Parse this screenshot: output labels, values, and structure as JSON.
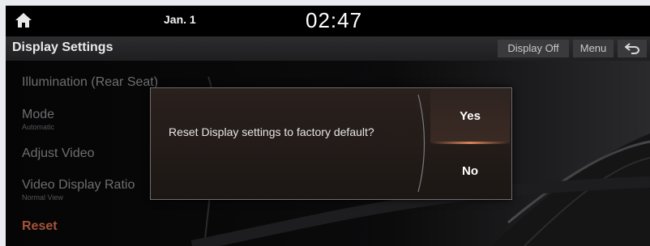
{
  "status_bar": {
    "home_icon": "home-icon",
    "date": "Jan. 1",
    "time": "02:47"
  },
  "title_bar": {
    "title": "Display Settings",
    "display_off_label": "Display Off",
    "menu_label": "Menu",
    "back_icon": "back-arrow-icon"
  },
  "settings_list": {
    "items": [
      {
        "label": "Illumination (Rear Seat)",
        "sub": ""
      },
      {
        "label": "Mode",
        "sub": "Automatic"
      },
      {
        "label": "Adjust Video",
        "sub": ""
      },
      {
        "label": "Video Display Ratio",
        "sub": "Normal View"
      },
      {
        "label": "Reset",
        "sub": ""
      }
    ]
  },
  "dialog": {
    "message": "Reset Display settings to factory default?",
    "yes_label": "Yes",
    "no_label": "No"
  },
  "colors": {
    "background": "#000000",
    "accent": "#d9855a",
    "reset_text": "#a7533a",
    "dim_text": "#6e6e72"
  }
}
